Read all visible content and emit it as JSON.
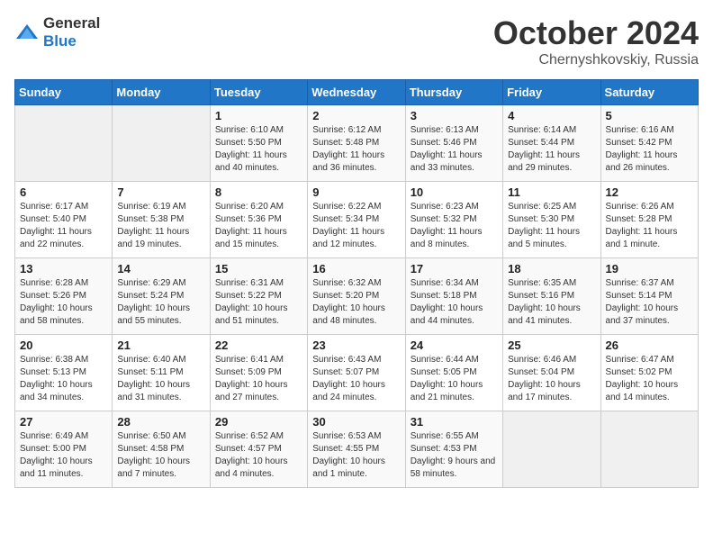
{
  "logo": {
    "general": "General",
    "blue": "Blue"
  },
  "title": "October 2024",
  "location": "Chernyshkovskiy, Russia",
  "headers": [
    "Sunday",
    "Monday",
    "Tuesday",
    "Wednesday",
    "Thursday",
    "Friday",
    "Saturday"
  ],
  "weeks": [
    [
      {
        "day": "",
        "info": ""
      },
      {
        "day": "",
        "info": ""
      },
      {
        "day": "1",
        "info": "Sunrise: 6:10 AM\nSunset: 5:50 PM\nDaylight: 11 hours and 40 minutes."
      },
      {
        "day": "2",
        "info": "Sunrise: 6:12 AM\nSunset: 5:48 PM\nDaylight: 11 hours and 36 minutes."
      },
      {
        "day": "3",
        "info": "Sunrise: 6:13 AM\nSunset: 5:46 PM\nDaylight: 11 hours and 33 minutes."
      },
      {
        "day": "4",
        "info": "Sunrise: 6:14 AM\nSunset: 5:44 PM\nDaylight: 11 hours and 29 minutes."
      },
      {
        "day": "5",
        "info": "Sunrise: 6:16 AM\nSunset: 5:42 PM\nDaylight: 11 hours and 26 minutes."
      }
    ],
    [
      {
        "day": "6",
        "info": "Sunrise: 6:17 AM\nSunset: 5:40 PM\nDaylight: 11 hours and 22 minutes."
      },
      {
        "day": "7",
        "info": "Sunrise: 6:19 AM\nSunset: 5:38 PM\nDaylight: 11 hours and 19 minutes."
      },
      {
        "day": "8",
        "info": "Sunrise: 6:20 AM\nSunset: 5:36 PM\nDaylight: 11 hours and 15 minutes."
      },
      {
        "day": "9",
        "info": "Sunrise: 6:22 AM\nSunset: 5:34 PM\nDaylight: 11 hours and 12 minutes."
      },
      {
        "day": "10",
        "info": "Sunrise: 6:23 AM\nSunset: 5:32 PM\nDaylight: 11 hours and 8 minutes."
      },
      {
        "day": "11",
        "info": "Sunrise: 6:25 AM\nSunset: 5:30 PM\nDaylight: 11 hours and 5 minutes."
      },
      {
        "day": "12",
        "info": "Sunrise: 6:26 AM\nSunset: 5:28 PM\nDaylight: 11 hours and 1 minute."
      }
    ],
    [
      {
        "day": "13",
        "info": "Sunrise: 6:28 AM\nSunset: 5:26 PM\nDaylight: 10 hours and 58 minutes."
      },
      {
        "day": "14",
        "info": "Sunrise: 6:29 AM\nSunset: 5:24 PM\nDaylight: 10 hours and 55 minutes."
      },
      {
        "day": "15",
        "info": "Sunrise: 6:31 AM\nSunset: 5:22 PM\nDaylight: 10 hours and 51 minutes."
      },
      {
        "day": "16",
        "info": "Sunrise: 6:32 AM\nSunset: 5:20 PM\nDaylight: 10 hours and 48 minutes."
      },
      {
        "day": "17",
        "info": "Sunrise: 6:34 AM\nSunset: 5:18 PM\nDaylight: 10 hours and 44 minutes."
      },
      {
        "day": "18",
        "info": "Sunrise: 6:35 AM\nSunset: 5:16 PM\nDaylight: 10 hours and 41 minutes."
      },
      {
        "day": "19",
        "info": "Sunrise: 6:37 AM\nSunset: 5:14 PM\nDaylight: 10 hours and 37 minutes."
      }
    ],
    [
      {
        "day": "20",
        "info": "Sunrise: 6:38 AM\nSunset: 5:13 PM\nDaylight: 10 hours and 34 minutes."
      },
      {
        "day": "21",
        "info": "Sunrise: 6:40 AM\nSunset: 5:11 PM\nDaylight: 10 hours and 31 minutes."
      },
      {
        "day": "22",
        "info": "Sunrise: 6:41 AM\nSunset: 5:09 PM\nDaylight: 10 hours and 27 minutes."
      },
      {
        "day": "23",
        "info": "Sunrise: 6:43 AM\nSunset: 5:07 PM\nDaylight: 10 hours and 24 minutes."
      },
      {
        "day": "24",
        "info": "Sunrise: 6:44 AM\nSunset: 5:05 PM\nDaylight: 10 hours and 21 minutes."
      },
      {
        "day": "25",
        "info": "Sunrise: 6:46 AM\nSunset: 5:04 PM\nDaylight: 10 hours and 17 minutes."
      },
      {
        "day": "26",
        "info": "Sunrise: 6:47 AM\nSunset: 5:02 PM\nDaylight: 10 hours and 14 minutes."
      }
    ],
    [
      {
        "day": "27",
        "info": "Sunrise: 6:49 AM\nSunset: 5:00 PM\nDaylight: 10 hours and 11 minutes."
      },
      {
        "day": "28",
        "info": "Sunrise: 6:50 AM\nSunset: 4:58 PM\nDaylight: 10 hours and 7 minutes."
      },
      {
        "day": "29",
        "info": "Sunrise: 6:52 AM\nSunset: 4:57 PM\nDaylight: 10 hours and 4 minutes."
      },
      {
        "day": "30",
        "info": "Sunrise: 6:53 AM\nSunset: 4:55 PM\nDaylight: 10 hours and 1 minute."
      },
      {
        "day": "31",
        "info": "Sunrise: 6:55 AM\nSunset: 4:53 PM\nDaylight: 9 hours and 58 minutes."
      },
      {
        "day": "",
        "info": ""
      },
      {
        "day": "",
        "info": ""
      }
    ]
  ]
}
